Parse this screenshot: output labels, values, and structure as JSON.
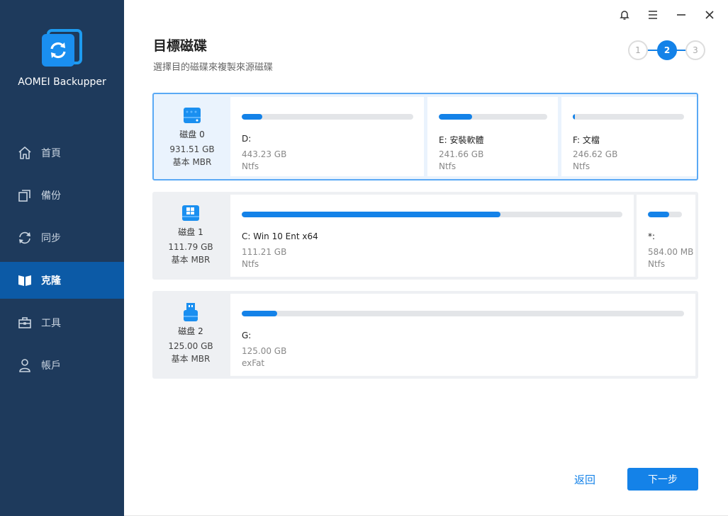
{
  "app": {
    "name": "AOMEI Backupper"
  },
  "sidebar": {
    "items": [
      {
        "label": "首頁",
        "icon": "home-icon"
      },
      {
        "label": "備份",
        "icon": "backup-icon"
      },
      {
        "label": "同步",
        "icon": "sync-icon"
      },
      {
        "label": "克隆",
        "icon": "clone-icon",
        "active": true
      },
      {
        "label": "工具",
        "icon": "toolbox-icon"
      },
      {
        "label": "帳戶",
        "icon": "user-icon"
      }
    ]
  },
  "header": {
    "title": "目標磁碟",
    "subtitle": "選擇目的磁碟來複製來源磁碟"
  },
  "stepper": {
    "steps": [
      "1",
      "2",
      "3"
    ],
    "current": 2
  },
  "disks": [
    {
      "name": "磁盘 0",
      "size": "931.51 GB",
      "type": "基本 MBR",
      "icon": "hdd-icon",
      "partitions": [
        {
          "label": "D:",
          "size": "443.23 GB",
          "fs": "Ntfs",
          "used": 0.12
        },
        {
          "label": "E: 安裝軟體",
          "size": "241.66 GB",
          "fs": "Ntfs",
          "used": 0.31
        },
        {
          "label": "F: 文檔",
          "size": "246.62 GB",
          "fs": "Ntfs",
          "used": 0.02
        }
      ]
    },
    {
      "name": "磁盘 1",
      "size": "111.79 GB",
      "type": "基本 MBR",
      "icon": "windows-disk-icon",
      "partitions": [
        {
          "label": "C: Win 10 Ent x64",
          "size": "111.21 GB",
          "fs": "Ntfs",
          "used": 0.68
        },
        {
          "label": "*:",
          "size": "584.00 MB",
          "fs": "Ntfs",
          "used": 0.62
        }
      ]
    },
    {
      "name": "磁盘 2",
      "size": "125.00 GB",
      "type": "基本 MBR",
      "icon": "usb-icon",
      "partitions": [
        {
          "label": "G:",
          "size": "125.00 GB",
          "fs": "exFat",
          "used": 0.08
        }
      ]
    }
  ],
  "footer": {
    "back_label": "返回",
    "next_label": "下一步"
  },
  "colors": {
    "accent": "#1482e8",
    "sidebar": "#1e3a5c",
    "sidebar_active": "#0c5aa6"
  }
}
